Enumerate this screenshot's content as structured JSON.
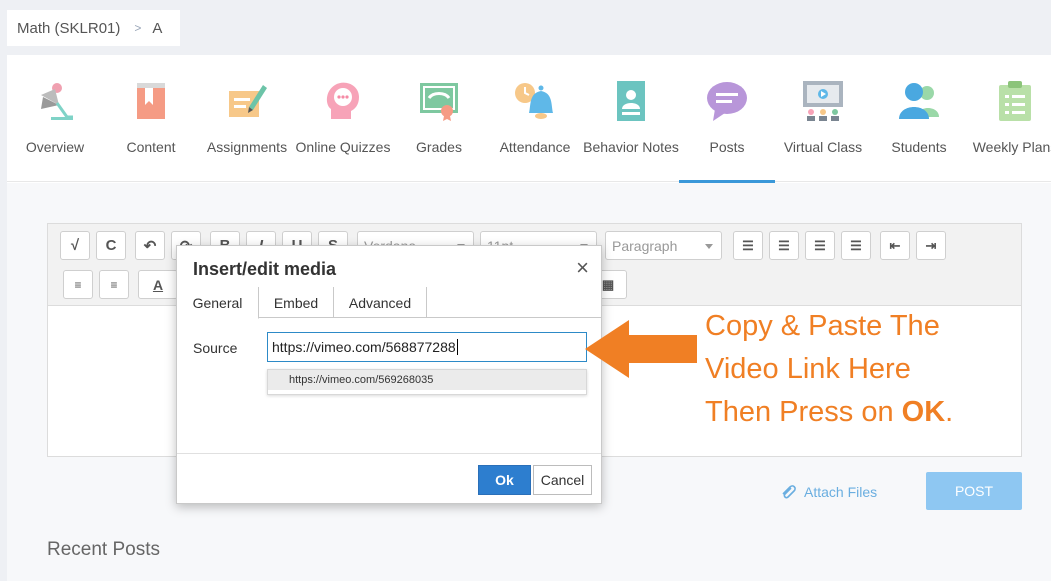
{
  "breadcrumb": {
    "course": "Math (SKLR01)",
    "separator": ">",
    "current": "A"
  },
  "nav": {
    "items": [
      {
        "label": "Overview",
        "icon": "lamp-icon"
      },
      {
        "label": "Content",
        "icon": "book-icon"
      },
      {
        "label": "Assignments",
        "icon": "pencil-paper-icon"
      },
      {
        "label": "Online Quizzes",
        "icon": "quiz-head-icon"
      },
      {
        "label": "Grades",
        "icon": "certificate-icon"
      },
      {
        "label": "Attendance",
        "icon": "bell-clock-icon"
      },
      {
        "label": "Behavior Notes",
        "icon": "person-board-icon"
      },
      {
        "label": "Posts",
        "icon": "chat-bubble-icon"
      },
      {
        "label": "Virtual Class",
        "icon": "video-class-icon"
      },
      {
        "label": "Students",
        "icon": "users-icon"
      },
      {
        "label": "Weekly Plans",
        "icon": "clipboard-icon"
      }
    ],
    "active": "Posts"
  },
  "editor": {
    "font_family": "Verdana",
    "font_size": "11pt",
    "block_format": "Paragraph"
  },
  "attach_label": "Attach Files",
  "post_label": "POST",
  "recent_posts_heading": "Recent Posts",
  "modal": {
    "title": "Insert/edit media",
    "close": "×",
    "tabs": [
      "General",
      "Embed",
      "Advanced"
    ],
    "active_tab": "General",
    "source_label": "Source",
    "source_value": "https://vimeo.com/568877288",
    "suggestion": "https://vimeo.com/569268035",
    "ok_label": "Ok",
    "cancel_label": "Cancel"
  },
  "annotation": {
    "line1": "Copy & Paste The",
    "line2": "Video Link Here",
    "line3_prefix": "Then Press on ",
    "line3_bold": "OK",
    "line3_suffix": "."
  },
  "colors": {
    "accent": "#3a98d9",
    "annotation": "#f07f24",
    "ok_button": "#2d7ecf",
    "post_button": "#8ec7f2"
  }
}
